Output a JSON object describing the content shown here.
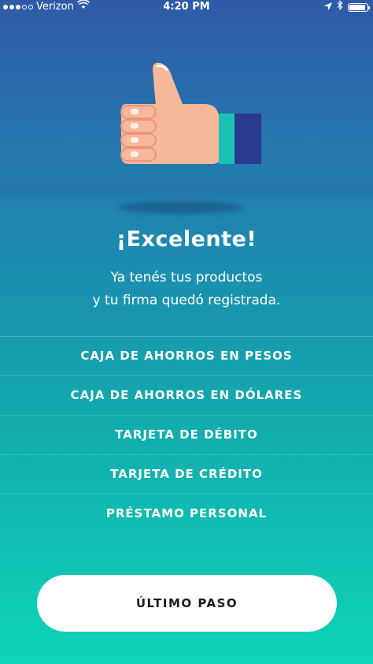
{
  "status_bar": {
    "carrier": "Verizon",
    "time": "4:20 PM",
    "icons": [
      "signal-dots",
      "wifi-icon",
      "location-arrow-icon",
      "bluetooth-icon",
      "battery-icon"
    ]
  },
  "illustration": {
    "icon": "thumbs-up-icon",
    "colors": {
      "skin": "#f6b89a",
      "skin_shadow": "#e9967a",
      "cuff_blue": "#2b3a8f",
      "cuff_teal": "#18c3b6"
    }
  },
  "headline": {
    "title": "¡Excelente!",
    "subtitle_line1": "Ya tenés tus productos",
    "subtitle_line2": "y tu firma quedó registrada."
  },
  "products": [
    "CAJA DE AHORROS EN PESOS",
    "CAJA DE AHORROS EN DÓLARES",
    "TARJETA DE DÉBITO",
    "TARJETA DE CRÉDITO",
    "PRÉSTAMO PERSONAL"
  ],
  "cta": {
    "label": "ÚLTIMO PASO"
  },
  "colors": {
    "gradient_top": "#2f5aa8",
    "gradient_bottom": "#0ed4b8",
    "button_bg": "#ffffff",
    "button_text": "#1a1a1a"
  }
}
